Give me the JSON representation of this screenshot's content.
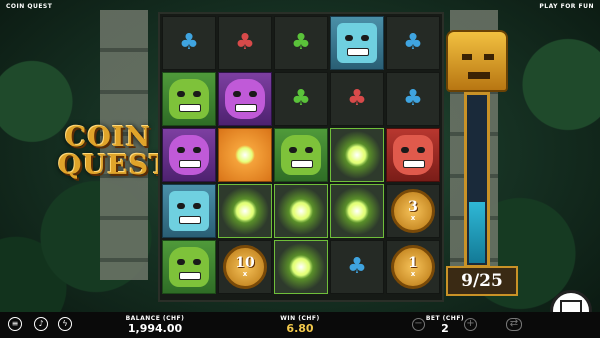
{
  "header": {
    "game_title": "COIN QUEST",
    "play_mode": "PLAY FOR FUN"
  },
  "logo": {
    "line1": "COIN",
    "line2": "QUEST"
  },
  "counter": {
    "text": "9/25",
    "progress_fraction": 0.36
  },
  "footer": {
    "balance_label": "BALANCE (CHF)",
    "balance_value": "1,994.00",
    "win_label": "WIN (CHF)",
    "win_value": "6.80",
    "bet_label": "BET (CHF)",
    "bet_value": "2",
    "menu_icon": "menu-icon",
    "sound_icon": "sound-icon",
    "turbo_icon": "turbo-icon"
  },
  "grid": [
    [
      "gem-blue",
      "gem-red",
      "gem-green",
      "mask-teal",
      "gem-blue"
    ],
    [
      "mask-green",
      "mask-purple",
      "gem-green",
      "gem-red",
      "gem-blue"
    ],
    [
      "mask-purple",
      "spark-orange",
      "mask-green",
      "crack",
      "mask-red"
    ],
    [
      "mask-teal",
      "crack",
      "crack",
      "crack",
      "coin-3"
    ],
    [
      "mask-green",
      "coin-10",
      "crack",
      "gem-blue",
      "coin-1"
    ]
  ],
  "coins": {
    "c3": {
      "value": "3",
      "mult": "x"
    },
    "c10": {
      "value": "10",
      "mult": "x"
    },
    "c1": {
      "value": "1",
      "mult": "x"
    }
  }
}
